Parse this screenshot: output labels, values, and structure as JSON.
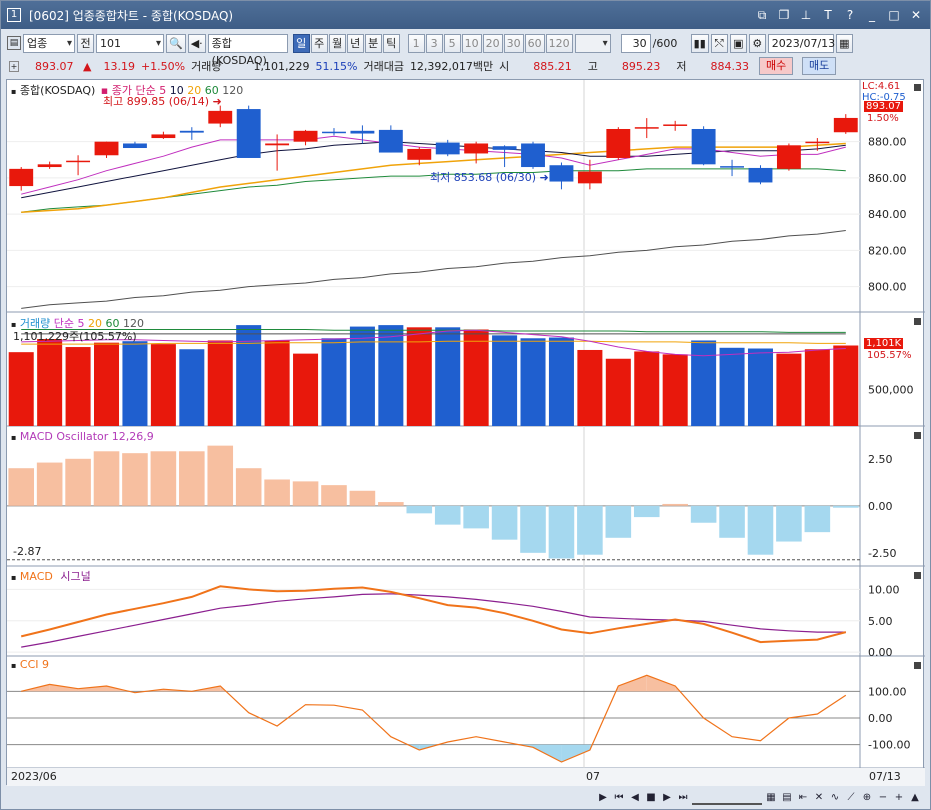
{
  "window": {
    "number": "1",
    "title": "[0602] 업종종합차트 - 종합(KOSDAQ)"
  },
  "toolbar": {
    "market_select": "업종",
    "prev_label": "전",
    "code": "101",
    "name": "종합(KOSDAQ)",
    "period_tabs": [
      "일",
      "주",
      "월",
      "년",
      "분",
      "틱"
    ],
    "active_period": "일",
    "interval_buttons": [
      "1",
      "3",
      "5",
      "10",
      "20",
      "30",
      "60",
      "120"
    ],
    "count": "30",
    "max_count": "/600",
    "date": "2023/07/13"
  },
  "price": {
    "current": "893.07",
    "change": "13.19",
    "change_pct": "+1.50%",
    "volume_label": "거래량",
    "volume": "1,101,229",
    "volume_pct": "51.15%",
    "amount_label": "거래대금",
    "amount": "12,392,017백만",
    "open_label": "시",
    "open": "885.21",
    "high_label": "고",
    "high": "895.23",
    "low_label": "저",
    "low": "884.33",
    "buy_label": "매수",
    "sell_label": "매도"
  },
  "colors": {
    "up": "#e8180c",
    "down": "#1f5fcf",
    "ma5": "#c02fbf",
    "ma10": "#11143f",
    "ma20": "#f0a30a",
    "ma60": "#1f8a3b",
    "ma120": "#505050",
    "macd_pos": "#f7bfa0",
    "macd_neg": "#a5d8ef",
    "macd_line": "#f0731a",
    "signal_line": "#8b1f8f",
    "cci_line": "#f0731a"
  },
  "price_panel": {
    "title": "종합(KOSDAQ)",
    "ma_title": "종가 단순",
    "ma_periods": [
      "5",
      "10",
      "20",
      "60",
      "120"
    ],
    "high_note": "최고 899.85 (06/14)",
    "low_note": "최저 853.68 (06/30)",
    "lc_label": "LC:4.61",
    "hc_label": "HC:-0.75",
    "last_price_tag": "893.07",
    "last_pct_tag": "1.50%",
    "y_ticks": [
      "880.00",
      "860.00",
      "840.00",
      "820.00",
      "800.00"
    ]
  },
  "volume_panel": {
    "title": "거래량",
    "ma_title": "단순",
    "ma_periods": [
      "5",
      "20",
      "60",
      "120"
    ],
    "last_note": "1,101,229주(105.57%)",
    "last_tag": "1,101K",
    "last_pct_tag": "105.57%",
    "y_ticks": [
      "500,000"
    ]
  },
  "macd_osc_panel": {
    "title": "MACD Oscillator 12,26,9",
    "min_note": "-2.87",
    "y_ticks": [
      "2.50",
      "0.00",
      "-2.50"
    ]
  },
  "macd_panel": {
    "title": "MACD",
    "signal_title": "시그널",
    "y_ticks": [
      "10.00",
      "5.00",
      "0.00"
    ]
  },
  "cci_panel": {
    "title": "CCI 9",
    "y_ticks": [
      "100.00",
      "0.00",
      "-100.00"
    ]
  },
  "x_axis": {
    "labels": [
      "2023/06",
      "07"
    ],
    "end_label": "07/13"
  },
  "chart_data": {
    "type": "candlestick",
    "candles": [
      {
        "o": 855.5,
        "h": 866.0,
        "l": 853.0,
        "c": 865.0
      },
      {
        "o": 866.0,
        "h": 869.0,
        "l": 865.0,
        "c": 867.5
      },
      {
        "o": 869.5,
        "h": 872.5,
        "l": 861.5,
        "c": 869.5
      },
      {
        "o": 872.5,
        "h": 880.0,
        "l": 871.0,
        "c": 880.0
      },
      {
        "o": 879.0,
        "h": 880.0,
        "l": 876.5,
        "c": 876.5
      },
      {
        "o": 882.0,
        "h": 885.5,
        "l": 881.5,
        "c": 884.0
      },
      {
        "o": 886.0,
        "h": 888.0,
        "l": 881.0,
        "c": 885.0
      },
      {
        "o": 890.0,
        "h": 899.9,
        "l": 888.0,
        "c": 897.0
      },
      {
        "o": 898.0,
        "h": 899.9,
        "l": 871.0,
        "c": 871.0
      },
      {
        "o": 878.0,
        "h": 884.0,
        "l": 864.0,
        "c": 879.0
      },
      {
        "o": 880.0,
        "h": 886.5,
        "l": 878.0,
        "c": 886.0
      },
      {
        "o": 885.5,
        "h": 887.5,
        "l": 883.5,
        "c": 885.0
      },
      {
        "o": 886.0,
        "h": 889.0,
        "l": 879.0,
        "c": 884.5
      },
      {
        "o": 886.5,
        "h": 889.0,
        "l": 874.0,
        "c": 874.0
      },
      {
        "o": 870.0,
        "h": 877.0,
        "l": 867.0,
        "c": 876.0
      },
      {
        "o": 879.5,
        "h": 881.0,
        "l": 872.0,
        "c": 873.0
      },
      {
        "o": 873.5,
        "h": 880.0,
        "l": 868.0,
        "c": 879.0
      },
      {
        "o": 877.5,
        "h": 878.0,
        "l": 866.0,
        "c": 875.5
      },
      {
        "o": 879.0,
        "h": 880.0,
        "l": 865.0,
        "c": 866.0
      },
      {
        "o": 867.0,
        "h": 868.5,
        "l": 853.7,
        "c": 858.0
      },
      {
        "o": 857.0,
        "h": 870.0,
        "l": 853.7,
        "c": 863.5
      },
      {
        "o": 871.0,
        "h": 888.0,
        "l": 870.0,
        "c": 887.0
      },
      {
        "o": 887.5,
        "h": 893.0,
        "l": 882.0,
        "c": 888.0
      },
      {
        "o": 889.0,
        "h": 891.5,
        "l": 886.0,
        "c": 889.5
      },
      {
        "o": 887.0,
        "h": 888.5,
        "l": 867.0,
        "c": 867.5
      },
      {
        "o": 866.5,
        "h": 870.0,
        "l": 861.0,
        "c": 866.0
      },
      {
        "o": 865.5,
        "h": 867.0,
        "l": 856.5,
        "c": 857.5
      },
      {
        "o": 865.0,
        "h": 879.0,
        "l": 864.0,
        "c": 878.0
      },
      {
        "o": 880.0,
        "h": 882.0,
        "l": 875.0,
        "c": 880.0
      },
      {
        "o": 885.2,
        "h": 895.2,
        "l": 884.3,
        "c": 893.1
      }
    ],
    "ma5": [
      851,
      855,
      859,
      864,
      868,
      872,
      877,
      881,
      881,
      881,
      881,
      883,
      881,
      879,
      877,
      876,
      875,
      874,
      873,
      871,
      867,
      870,
      873,
      876,
      876,
      874,
      872,
      873,
      873,
      877
    ],
    "ma10": [
      849,
      852,
      855,
      858,
      861,
      864,
      867,
      870,
      873,
      875,
      876,
      878,
      879,
      880,
      879,
      878,
      877,
      876,
      875,
      874,
      872,
      872,
      872,
      873,
      874,
      875,
      875,
      875,
      876,
      878
    ],
    "ma20": [
      841,
      842,
      843,
      845,
      847,
      849,
      852,
      855,
      857,
      859,
      861,
      863,
      865,
      867,
      868,
      869,
      870,
      871,
      872,
      873,
      874,
      875,
      876,
      877,
      877,
      877,
      877,
      877,
      878,
      879
    ],
    "ma60": [
      841,
      843,
      844,
      845,
      847,
      849,
      851,
      853,
      855,
      856,
      858,
      859,
      860,
      861,
      861,
      862,
      862,
      863,
      863,
      864,
      864,
      864,
      865,
      865,
      865,
      865,
      865,
      865,
      865,
      864
    ],
    "ma120": [
      788,
      790,
      791,
      792,
      794,
      795,
      797,
      798,
      800,
      801,
      802,
      804,
      805,
      807,
      808,
      810,
      811,
      813,
      814,
      816,
      817,
      819,
      820,
      822,
      823,
      825,
      826,
      828,
      829,
      831
    ],
    "volume": [
      1010000,
      1190000,
      1080000,
      1140000,
      1160000,
      1120000,
      1050000,
      1170000,
      1380000,
      1170000,
      990000,
      1200000,
      1360000,
      1380000,
      1350000,
      1350000,
      1320000,
      1240000,
      1200000,
      1210000,
      1040000,
      920000,
      1020000,
      980000,
      1170000,
      1070000,
      1060000,
      990000,
      1050000,
      1101229
    ],
    "vol_ma5": [
      1150000,
      1160000,
      1170000,
      1180000,
      1180000,
      1170000,
      1160000,
      1150000,
      1160000,
      1170000,
      1180000,
      1190000,
      1200000,
      1220000,
      1260000,
      1300000,
      1310000,
      1280000,
      1250000,
      1220000,
      1160000,
      1080000,
      1020000,
      980000,
      960000,
      980000,
      1000000,
      1010000,
      1040000,
      1060000
    ],
    "vol_ma20": [
      1120000,
      1120000,
      1120000,
      1120000,
      1120000,
      1130000,
      1130000,
      1130000,
      1130000,
      1140000,
      1140000,
      1140000,
      1150000,
      1150000,
      1150000,
      1160000,
      1160000,
      1160000,
      1160000,
      1160000,
      1160000,
      1150000,
      1150000,
      1150000,
      1140000,
      1140000,
      1140000,
      1140000,
      1130000,
      1130000
    ],
    "vol_ma60": [
      1320000,
      1320000,
      1320000,
      1320000,
      1320000,
      1320000,
      1320000,
      1320000,
      1320000,
      1320000,
      1320000,
      1310000,
      1310000,
      1310000,
      1310000,
      1310000,
      1310000,
      1300000,
      1300000,
      1300000,
      1300000,
      1300000,
      1290000,
      1290000,
      1290000,
      1290000,
      1290000,
      1280000,
      1280000,
      1280000
    ],
    "vol_ma120": [
      1260000,
      1260000,
      1260000,
      1260000,
      1260000,
      1260000,
      1260000,
      1260000,
      1260000,
      1260000,
      1260000,
      1260000,
      1260000,
      1260000,
      1260000,
      1260000,
      1260000,
      1260000,
      1260000,
      1260000,
      1260000,
      1260000,
      1260000,
      1260000,
      1260000,
      1260000,
      1260000,
      1260000,
      1260000,
      1260000
    ],
    "macd_osc": [
      2.0,
      2.3,
      2.5,
      2.9,
      2.8,
      2.9,
      2.9,
      3.2,
      2.0,
      1.4,
      1.3,
      1.1,
      0.8,
      0.2,
      -0.4,
      -1.0,
      -1.2,
      -1.8,
      -2.5,
      -2.8,
      -2.6,
      -1.7,
      -0.6,
      0.1,
      -0.9,
      -1.7,
      -2.6,
      -1.9,
      -1.4,
      -0.1
    ],
    "macd": [
      2.5,
      3.6,
      4.8,
      6.0,
      6.9,
      7.8,
      8.8,
      10.5,
      10.0,
      9.7,
      9.8,
      10.1,
      10.3,
      9.6,
      8.6,
      7.5,
      7.1,
      6.2,
      5.0,
      3.6,
      3.0,
      3.8,
      4.5,
      5.2,
      4.5,
      3.1,
      1.6,
      1.8,
      2.0,
      3.2
    ],
    "signal": [
      0.8,
      1.6,
      2.5,
      3.4,
      4.3,
      5.2,
      6.1,
      7.0,
      7.5,
      8.1,
      8.5,
      8.8,
      9.2,
      9.3,
      9.1,
      8.8,
      8.4,
      7.9,
      7.3,
      6.5,
      5.6,
      5.4,
      5.2,
      5.1,
      4.9,
      4.3,
      3.7,
      3.4,
      3.2,
      3.2
    ],
    "cci": [
      100,
      126,
      110,
      120,
      95,
      108,
      100,
      120,
      20,
      -30,
      50,
      48,
      30,
      -70,
      -120,
      -90,
      -70,
      -90,
      -110,
      -165,
      -120,
      120,
      160,
      120,
      0,
      -70,
      -85,
      0,
      15,
      85
    ]
  }
}
